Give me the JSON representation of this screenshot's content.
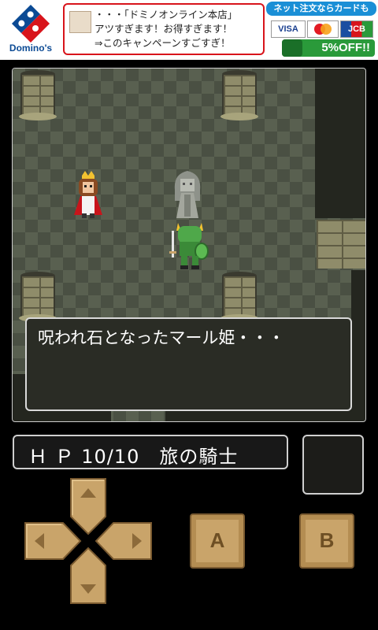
{
  "ad": {
    "brand": "Domino's",
    "bubble_lines": [
      "・・・「ドミノオンライン本店」",
      "アツすぎます！お得すぎます！",
      "⇒このキャンペーンすごすぎ！"
    ],
    "top_label": "ネット注文ならカードもOK!",
    "cards": [
      "VISA",
      "MasterCard",
      "JCB"
    ],
    "discount": "5%OFF!!",
    "discount_tag": "ネット注文"
  },
  "dialog": {
    "text": "呪われ石となったマール姫・・・"
  },
  "status": {
    "text": "Ｈ Ｐ 10/10　旅の騎士"
  },
  "controls": {
    "a_label": "A",
    "b_label": "B",
    "dpad_up_icon": "triangle-up",
    "dpad_down_icon": "triangle-down",
    "dpad_left_icon": "triangle-left",
    "dpad_right_icon": "triangle-right"
  },
  "colors": {
    "floor_light": "#596050",
    "floor_dark": "#4a5043",
    "button_face": "#c9a46a",
    "ad_red": "#d8141b"
  }
}
